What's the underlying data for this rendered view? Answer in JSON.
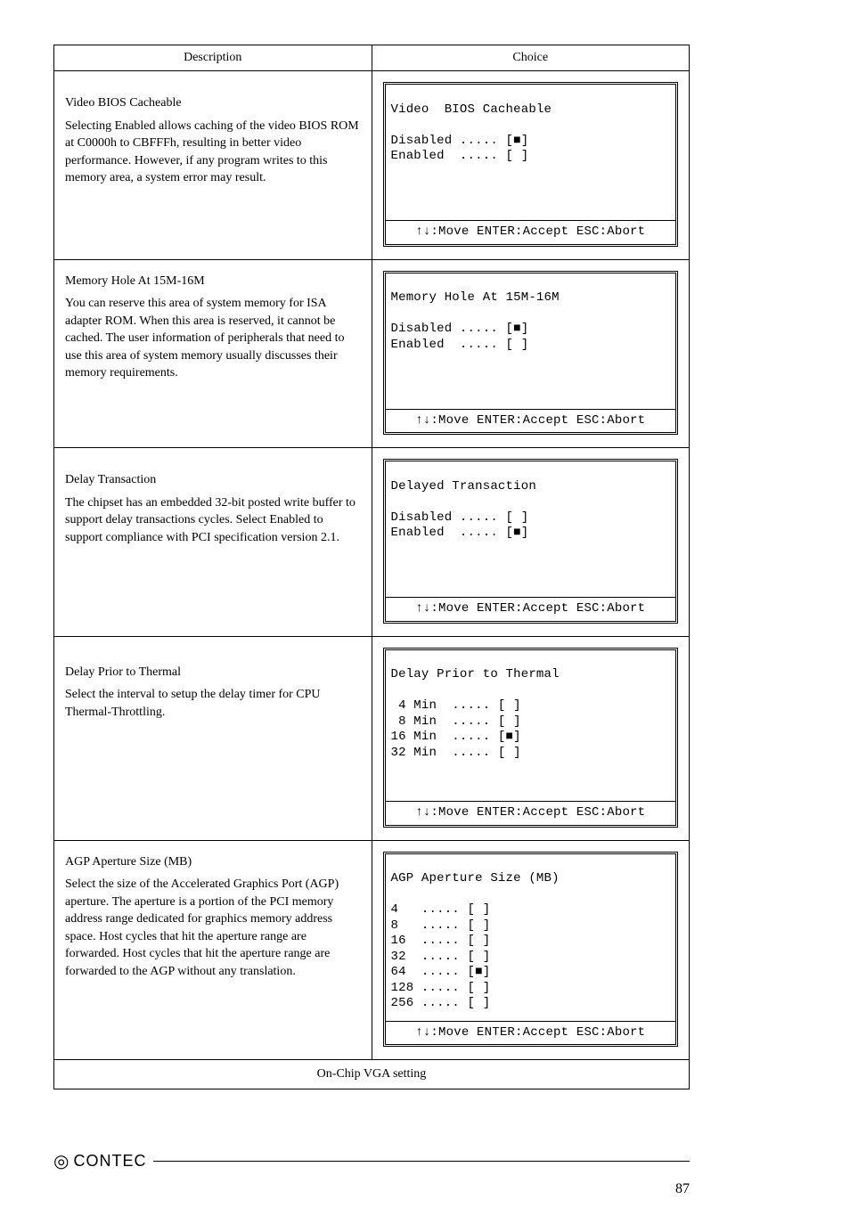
{
  "headers": {
    "description": "Description",
    "choice": "Choice"
  },
  "rows": [
    {
      "title": "Video BIOS Cacheable",
      "body": "Selecting Enabled allows caching of the video BIOS ROM at C0000h to CBFFFh, resulting in better video performance.   However, if any program writes to this memory area, a system error may result.",
      "bios_title": "Video  BIOS Cacheable",
      "bios_options": "Disabled ..... [■]\nEnabled  ..... [ ]",
      "footer": "↑↓:Move ENTER:Accept ESC:Abort"
    },
    {
      "title": "Memory Hole At 15M-16M",
      "body": "You can reserve this area of system memory for ISA adapter ROM.   When this area is reserved, it cannot be cached. The user information of peripherals that need to use this area of system memory usually discusses their memory requirements.",
      "bios_title": "Memory Hole At 15M-16M",
      "bios_options": "Disabled ..... [■]\nEnabled  ..... [ ]",
      "footer": "↑↓:Move ENTER:Accept ESC:Abort"
    },
    {
      "title": "Delay Transaction",
      "body": "The chipset has an embedded 32-bit posted write buffer to support delay transactions cycles.   Select Enabled to support compliance with PCI specification version 2.1.",
      "bios_title": "Delayed Transaction",
      "bios_options": "Disabled ..... [ ]\nEnabled  ..... [■]",
      "footer": "↑↓:Move ENTER:Accept ESC:Abort"
    },
    {
      "title": "Delay Prior to Thermal",
      "body": "Select the interval to setup the delay timer for CPU Thermal-Throttling.",
      "bios_title": "Delay Prior to Thermal",
      "bios_options": " 4 Min  ..... [ ]\n 8 Min  ..... [ ]\n16 Min  ..... [■]\n32 Min  ..... [ ]",
      "footer": "↑↓:Move ENTER:Accept ESC:Abort"
    },
    {
      "title": "AGP Aperture Size (MB)",
      "body": "Select the size of the Accelerated Graphics Port (AGP) aperture.   The aperture is a portion of the PCI memory address range dedicated for graphics memory address space.   Host cycles that hit the aperture range are forwarded.   Host cycles that hit the aperture range are forwarded to the AGP without any translation.",
      "bios_title": "AGP Aperture Size (MB)",
      "bios_options": "4   ..... [ ]\n8   ..... [ ]\n16  ..... [ ]\n32  ..... [ ]\n64  ..... [■]\n128 ..... [ ]\n256 ..... [ ]",
      "footer": "↑↓:Move ENTER:Accept ESC:Abort"
    }
  ],
  "onchip": "On-Chip VGA setting",
  "brand": "CONTEC",
  "page": "87"
}
